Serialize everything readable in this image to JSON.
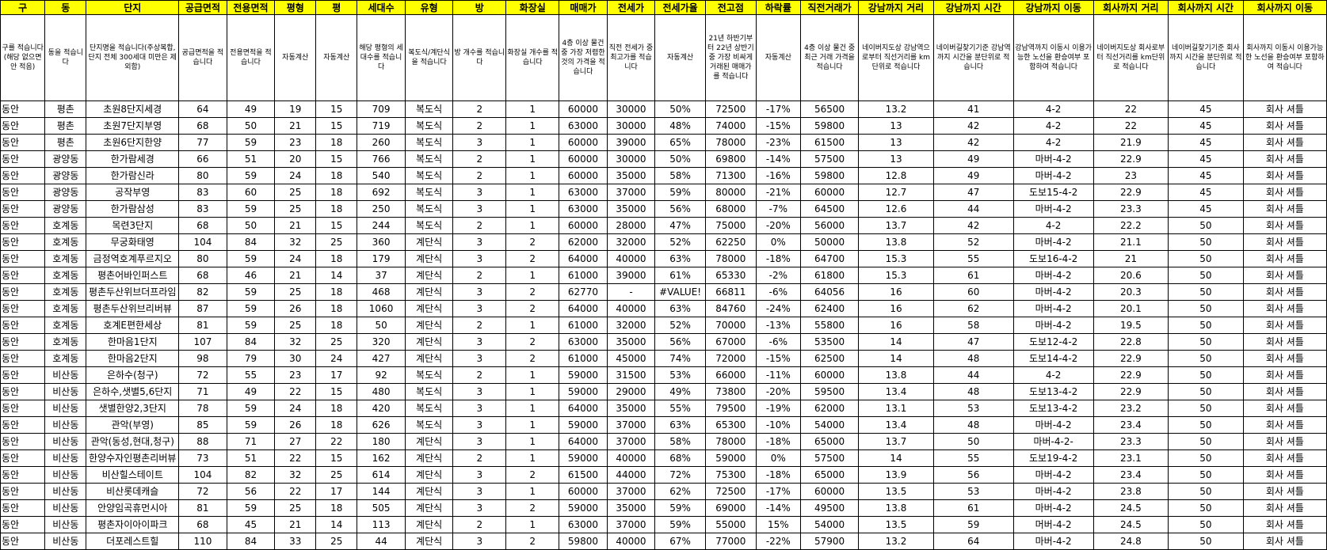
{
  "headers": [
    "구",
    "동",
    "단지",
    "공급면적",
    "전용면적",
    "평형",
    "평",
    "세대수",
    "유형",
    "방",
    "화장실",
    "매매가",
    "전세가",
    "전세가율",
    "전고점",
    "하락률",
    "직전거래가",
    "강남까지 거리",
    "강남까지 시간",
    "강남까지 이동",
    "회사까지 거리",
    "회사까지 시간",
    "회사까지 이동"
  ],
  "descriptions": [
    "구를 적습니다(해당 없으면 안 적음)",
    "동을 적습니다",
    "단지명을 적습니다(주상복합, 단지 전체 300세대 미만은 제외함)",
    "공급면적을 적습니다",
    "전용면적을 적습니다",
    "자동계산",
    "자동계산",
    "해당 평형의 세대수를 적습니다",
    "복도식/계단식을 적습니다",
    "방 개수를 적습니다",
    "화장실 개수를 적습니다",
    "4층 이상 물건 중 가장 저렴한 것의 가격을 적습니다",
    "직전 전세가 중 최고가를 적습니다",
    "자동계산",
    "21년 하반기부터 22년 상반기 중 가장 비싸게 거래된 매매가를 적습니다",
    "자동계산",
    "4층 이상 물건 중 최근 거래 가격을 적습니다",
    "네이버지도상 강남역으로부터 직선거리를 km단위로 적습니다",
    "네이버길찾기기준 강남역까지 시간을 분단위로 적습니다",
    "강남역까지 이동시 이용가능한 노선을 환승여부 포함하여 적습니다",
    "네이버지도상 회사로부터 직선거리를 km단위로 적습니다",
    "네이버길찾기기준 회사까지 시간을 분단위로 적습니다",
    "회사까지 이동시 이용가능한 노선을 환승여부 포함하여 적습니다"
  ],
  "rows": [
    [
      "동안",
      "평촌",
      "초원8단지세경",
      "64",
      "49",
      "19",
      "15",
      "709",
      "복도식",
      "2",
      "1",
      "60000",
      "30000",
      "50%",
      "72500",
      "-17%",
      "56500",
      "13.2",
      "41",
      "4-2",
      "22",
      "45",
      "회사 셔틀"
    ],
    [
      "동안",
      "평촌",
      "초원7단지부영",
      "68",
      "50",
      "21",
      "15",
      "719",
      "복도식",
      "2",
      "1",
      "63000",
      "30000",
      "48%",
      "74000",
      "-15%",
      "59800",
      "13",
      "42",
      "4-2",
      "22",
      "45",
      "회사 셔틀"
    ],
    [
      "동안",
      "평촌",
      "초원6단지한양",
      "77",
      "59",
      "23",
      "18",
      "260",
      "복도식",
      "3",
      "1",
      "60000",
      "39000",
      "65%",
      "78000",
      "-23%",
      "61500",
      "13",
      "42",
      "4-2",
      "21.9",
      "45",
      "회사 셔틀"
    ],
    [
      "동안",
      "광양동",
      "한가람세경",
      "66",
      "51",
      "20",
      "15",
      "766",
      "복도식",
      "2",
      "1",
      "60000",
      "30000",
      "50%",
      "69800",
      "-14%",
      "57500",
      "13",
      "49",
      "마버-4-2",
      "22.9",
      "45",
      "회사 셔틀"
    ],
    [
      "동안",
      "광양동",
      "한가람신라",
      "80",
      "59",
      "24",
      "18",
      "540",
      "복도식",
      "2",
      "1",
      "60000",
      "35000",
      "58%",
      "71300",
      "-16%",
      "59800",
      "12.8",
      "49",
      "마버-4-2",
      "23",
      "45",
      "회사 셔틀"
    ],
    [
      "동안",
      "광양동",
      "공작부영",
      "83",
      "60",
      "25",
      "18",
      "692",
      "복도식",
      "3",
      "1",
      "63000",
      "37000",
      "59%",
      "80000",
      "-21%",
      "60000",
      "12.7",
      "47",
      "도보15-4-2",
      "22.9",
      "45",
      "회사 셔틀"
    ],
    [
      "동안",
      "광양동",
      "한가람삼성",
      "83",
      "59",
      "25",
      "18",
      "250",
      "복도식",
      "3",
      "1",
      "63000",
      "35000",
      "56%",
      "68000",
      "-7%",
      "64500",
      "12.6",
      "44",
      "마버-4-2",
      "23.3",
      "45",
      "회사 셔틀"
    ],
    [
      "동안",
      "호계동",
      "목련3단지",
      "68",
      "50",
      "21",
      "15",
      "244",
      "복도식",
      "2",
      "1",
      "60000",
      "28000",
      "47%",
      "75000",
      "-20%",
      "56000",
      "13.7",
      "42",
      "4-2",
      "22.2",
      "50",
      "회사 셔틀"
    ],
    [
      "동안",
      "호계동",
      "무궁화태영",
      "104",
      "84",
      "32",
      "25",
      "360",
      "계단식",
      "3",
      "2",
      "62000",
      "32000",
      "52%",
      "62250",
      "0%",
      "50000",
      "13.8",
      "52",
      "마버-4-2",
      "21.1",
      "50",
      "회사 셔틀"
    ],
    [
      "동안",
      "호계동",
      "금정역호계푸르지오",
      "80",
      "59",
      "24",
      "18",
      "179",
      "계단식",
      "3",
      "2",
      "64000",
      "40000",
      "63%",
      "78000",
      "-18%",
      "64700",
      "15.3",
      "55",
      "도보16-4-2",
      "21",
      "50",
      "회사 셔틀"
    ],
    [
      "동안",
      "호계동",
      "평촌어바인퍼스트",
      "68",
      "46",
      "21",
      "14",
      "37",
      "계단식",
      "2",
      "1",
      "61000",
      "39000",
      "61%",
      "65330",
      "-2%",
      "61800",
      "15.3",
      "61",
      "마버-4-2",
      "20.6",
      "50",
      "회사 셔틀"
    ],
    [
      "동안",
      "호계동",
      "평촌두산위브더프라임",
      "82",
      "59",
      "25",
      "18",
      "468",
      "계단식",
      "3",
      "2",
      "62770",
      "-",
      "#VALUE!",
      "66811",
      "-6%",
      "64056",
      "16",
      "60",
      "마버-4-2",
      "20.3",
      "50",
      "회사 셔틀"
    ],
    [
      "동안",
      "호계동",
      "평촌두산위브리버뷰",
      "87",
      "59",
      "26",
      "18",
      "1060",
      "계단식",
      "3",
      "2",
      "64000",
      "40000",
      "63%",
      "84760",
      "-24%",
      "62400",
      "16",
      "62",
      "마버-4-2",
      "20.1",
      "50",
      "회사 셔틀"
    ],
    [
      "동안",
      "호계동",
      "호계E편한세상",
      "81",
      "59",
      "25",
      "18",
      "50",
      "계단식",
      "2",
      "1",
      "61000",
      "32000",
      "52%",
      "70000",
      "-13%",
      "55800",
      "16",
      "58",
      "마버-4-2",
      "19.5",
      "50",
      "회사 셔틀"
    ],
    [
      "동안",
      "호계동",
      "한마음1단지",
      "107",
      "84",
      "32",
      "25",
      "320",
      "계단식",
      "3",
      "2",
      "63000",
      "35000",
      "56%",
      "67000",
      "-6%",
      "53500",
      "14",
      "47",
      "도보12-4-2",
      "22.8",
      "50",
      "회사 셔틀"
    ],
    [
      "동안",
      "호계동",
      "한마음2단지",
      "98",
      "79",
      "30",
      "24",
      "427",
      "계단식",
      "3",
      "2",
      "61000",
      "45000",
      "74%",
      "72000",
      "-15%",
      "62500",
      "14",
      "48",
      "도보14-4-2",
      "22.9",
      "50",
      "회사 셔틀"
    ],
    [
      "동안",
      "비산동",
      "은하수(청구)",
      "72",
      "55",
      "23",
      "17",
      "92",
      "복도식",
      "2",
      "1",
      "59000",
      "31500",
      "53%",
      "66000",
      "-11%",
      "60000",
      "13.8",
      "44",
      "4-2",
      "22.9",
      "50",
      "회사 셔틀"
    ],
    [
      "동안",
      "비산동",
      "은하수,샛별5,6단지",
      "71",
      "49",
      "22",
      "15",
      "480",
      "복도식",
      "3",
      "1",
      "59000",
      "29000",
      "49%",
      "73800",
      "-20%",
      "59500",
      "13.4",
      "48",
      "도보13-4-2",
      "22.9",
      "50",
      "회사 셔틀"
    ],
    [
      "동안",
      "비산동",
      "샛별한양2,3단지",
      "78",
      "59",
      "24",
      "18",
      "420",
      "복도식",
      "3",
      "1",
      "64000",
      "35000",
      "55%",
      "79500",
      "-19%",
      "62000",
      "13.1",
      "53",
      "도보13-4-2",
      "23.2",
      "50",
      "회사 셔틀"
    ],
    [
      "동안",
      "비산동",
      "관악(부영)",
      "85",
      "59",
      "26",
      "18",
      "626",
      "복도식",
      "3",
      "1",
      "59000",
      "37000",
      "63%",
      "65300",
      "-10%",
      "54000",
      "13.4",
      "48",
      "마버-4-2",
      "23.4",
      "50",
      "회사 셔틀"
    ],
    [
      "동안",
      "비산동",
      "관악(동성,현대,청구)",
      "88",
      "71",
      "27",
      "22",
      "180",
      "계단식",
      "3",
      "1",
      "64000",
      "37000",
      "58%",
      "78000",
      "-18%",
      "65000",
      "13.7",
      "50",
      "마버-4-2-",
      "23.3",
      "50",
      "회사 셔틀"
    ],
    [
      "동안",
      "비산동",
      "한양수자인평촌리버뷰",
      "73",
      "51",
      "22",
      "15",
      "162",
      "계단식",
      "2",
      "1",
      "59000",
      "40000",
      "68%",
      "59000",
      "0%",
      "57500",
      "14",
      "55",
      "도보19-4-2",
      "23.1",
      "50",
      "회사 셔틀"
    ],
    [
      "동안",
      "비산동",
      "비산힐스테이트",
      "104",
      "82",
      "32",
      "25",
      "614",
      "계단식",
      "3",
      "2",
      "61500",
      "44000",
      "72%",
      "75300",
      "-18%",
      "65000",
      "13.9",
      "56",
      "마버-4-2",
      "23.4",
      "50",
      "회사 셔틀"
    ],
    [
      "동안",
      "비산동",
      "비산롯데캐슬",
      "72",
      "56",
      "22",
      "17",
      "144",
      "계단식",
      "3",
      "1",
      "60000",
      "37000",
      "62%",
      "72500",
      "-17%",
      "60000",
      "13.5",
      "53",
      "마버-4-2",
      "23.8",
      "50",
      "회사 셔틀"
    ],
    [
      "동안",
      "비산동",
      "안양임곡휴먼시아",
      "81",
      "59",
      "25",
      "18",
      "505",
      "계단식",
      "3",
      "2",
      "59000",
      "35000",
      "59%",
      "69000",
      "-14%",
      "49500",
      "13.8",
      "61",
      "마버-4-2",
      "24.5",
      "50",
      "회사 셔틀"
    ],
    [
      "동안",
      "비산동",
      "평촌자이아이파크",
      "68",
      "45",
      "21",
      "14",
      "113",
      "계단식",
      "2",
      "1",
      "63000",
      "37000",
      "59%",
      "55000",
      "15%",
      "54000",
      "13.5",
      "59",
      "머버-4-2",
      "24.5",
      "50",
      "회사 셔틀"
    ],
    [
      "동안",
      "비산동",
      "더포레스트힐",
      "110",
      "84",
      "33",
      "25",
      "44",
      "계단식",
      "3",
      "2",
      "59800",
      "40000",
      "67%",
      "77000",
      "-22%",
      "57900",
      "13.2",
      "64",
      "마버-4-2",
      "24.8",
      "50",
      "회사 셔틀"
    ]
  ]
}
